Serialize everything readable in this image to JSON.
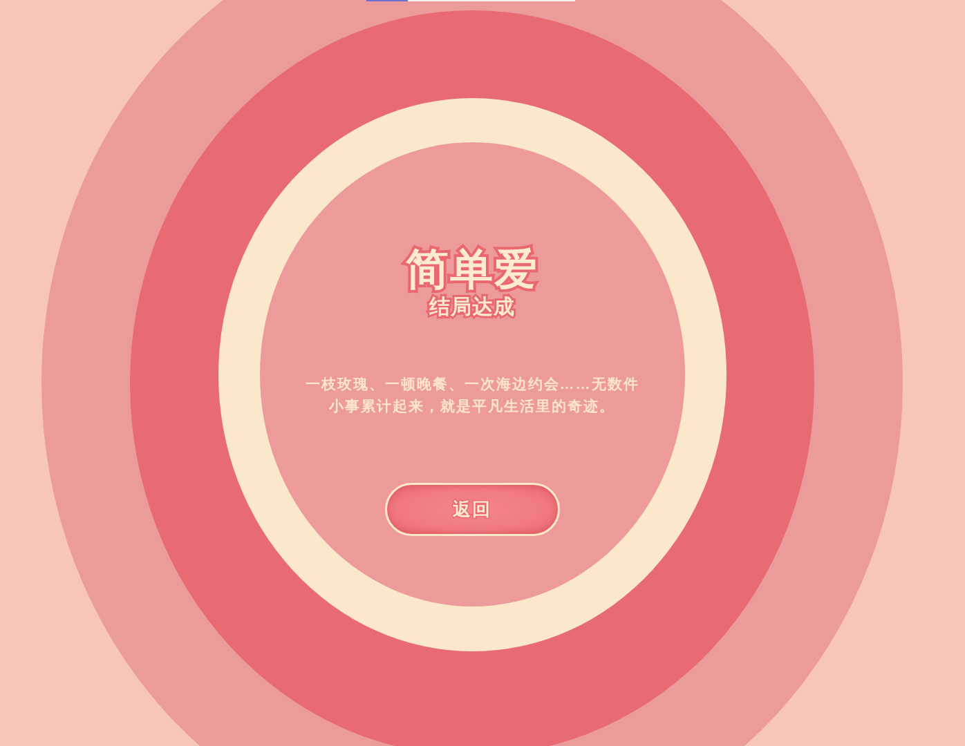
{
  "progress": {
    "level": 0.2
  },
  "ending": {
    "title": "简单爱",
    "subtitle": "结局达成",
    "description": "一枝玫瑰、一顿晚餐、一次海边约会……无数件小事累计起来，就是平凡生活里的奇迹。",
    "button": "返回"
  }
}
